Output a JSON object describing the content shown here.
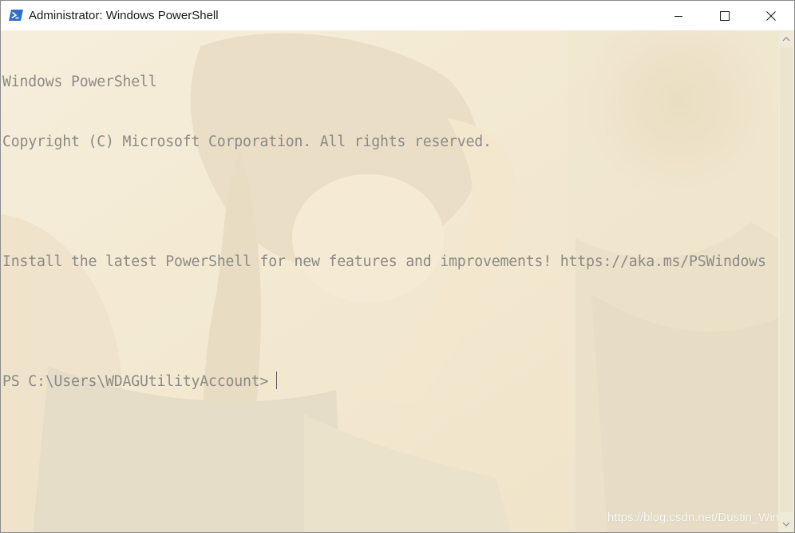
{
  "window": {
    "title": "Administrator: Windows PowerShell"
  },
  "icons": {
    "app": "powershell-icon",
    "minimize": "minimize-icon",
    "maximize": "maximize-icon",
    "close": "close-icon",
    "scroll_up": "chevron-up-icon",
    "scroll_down": "chevron-down-icon"
  },
  "console": {
    "lines": [
      "Windows PowerShell",
      "Copyright (C) Microsoft Corporation. All rights reserved.",
      "",
      "Install the latest PowerShell for new features and improvements! https://aka.ms/PSWindows",
      "",
      "PS C:\\Users\\WDAGUtilityAccount>"
    ],
    "text_color": "#8c8a86",
    "background_tint": "#f4ecd6"
  },
  "watermark": "https://blog.csdn.net/Dustin_Win"
}
